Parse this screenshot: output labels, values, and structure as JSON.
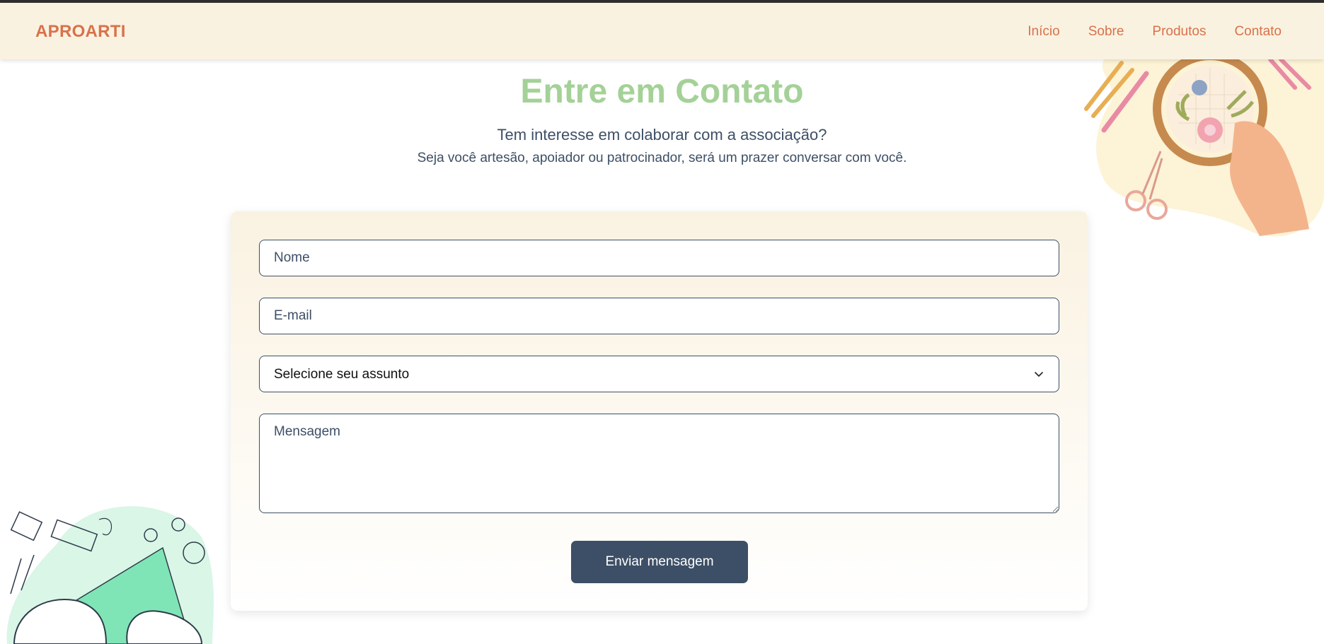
{
  "brand": "APROARTI",
  "nav": [
    "Início",
    "Sobre",
    "Produtos",
    "Contato"
  ],
  "title": "Entre em Contato",
  "subtitle": "Tem interesse em colaborar com a associação?",
  "subtext": "Seja você artesão, apoiador ou patrocinador, será um prazer conversar com você.",
  "form": {
    "name_placeholder": "Nome",
    "email_placeholder": "E-mail",
    "subject_selected": "Selecione seu assunto",
    "message_placeholder": "Mensagem",
    "submit_label": "Enviar mensagem"
  },
  "colors": {
    "brand": "#d9714a",
    "title": "#a4d197",
    "text": "#3d4f66",
    "navbar_bg": "#faf2e1",
    "button_bg": "#3d4f66"
  },
  "icons": {
    "select": "chevron-down-icon",
    "top_decoration": "embroidery-hoop-illustration",
    "bottom_decoration": "sewing-hands-illustration"
  }
}
